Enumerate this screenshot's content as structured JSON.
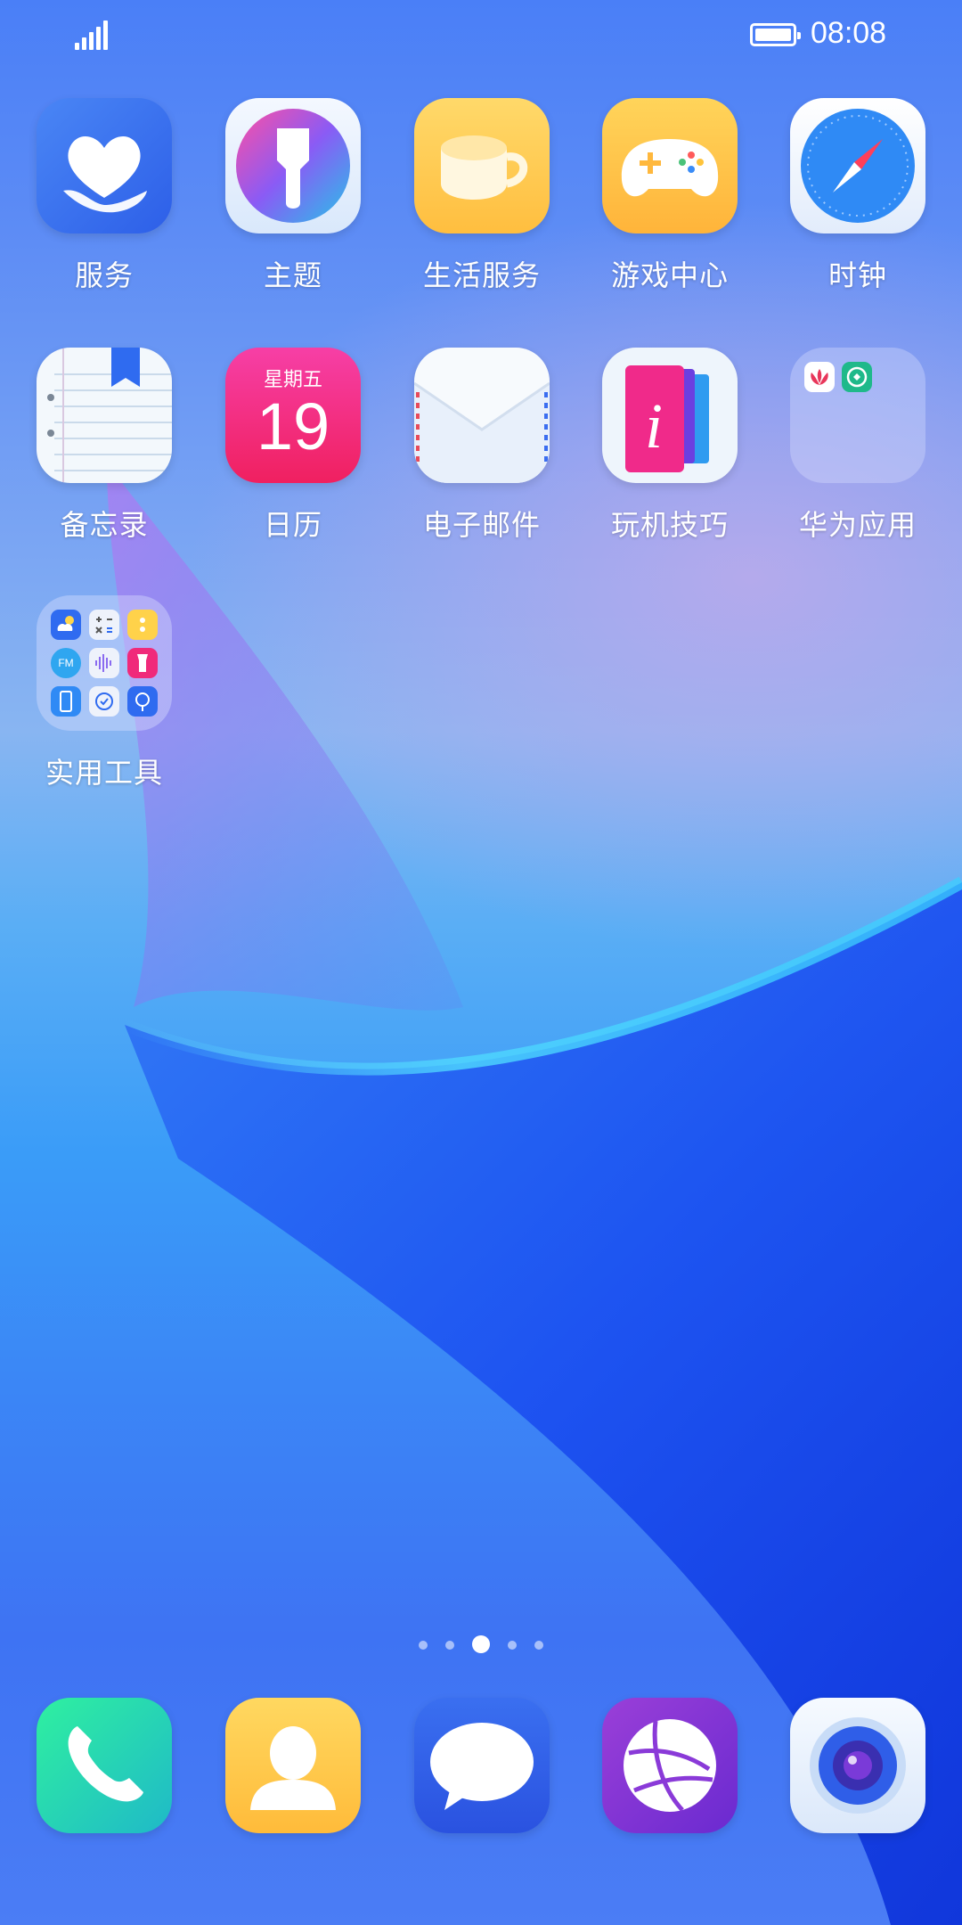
{
  "status": {
    "time": "08:08"
  },
  "apps": [
    {
      "label": "服务",
      "icon": "heart-hand-icon"
    },
    {
      "label": "主题",
      "icon": "paintbrush-icon"
    },
    {
      "label": "生活服务",
      "icon": "coffee-cup-icon"
    },
    {
      "label": "游戏中心",
      "icon": "gamepad-icon"
    },
    {
      "label": "时钟",
      "icon": "compass-clock-icon"
    },
    {
      "label": "备忘录",
      "icon": "notepad-icon"
    },
    {
      "label": "日历",
      "icon": "calendar-icon",
      "weekday": "星期五",
      "day": "19"
    },
    {
      "label": "电子邮件",
      "icon": "envelope-icon"
    },
    {
      "label": "玩机技巧",
      "icon": "tips-icon"
    },
    {
      "label": "华为应用",
      "icon": "folder-icon"
    },
    {
      "label": "实用工具",
      "icon": "folder-icon",
      "mini_text": "FM"
    }
  ],
  "page_indicator": {
    "count": 5,
    "active": 3
  },
  "dock": [
    {
      "name": "phone",
      "icon": "phone-icon"
    },
    {
      "name": "contacts",
      "icon": "contacts-icon"
    },
    {
      "name": "messages",
      "icon": "message-bubble-icon"
    },
    {
      "name": "browser",
      "icon": "globe-icon"
    },
    {
      "name": "camera",
      "icon": "camera-icon"
    }
  ]
}
